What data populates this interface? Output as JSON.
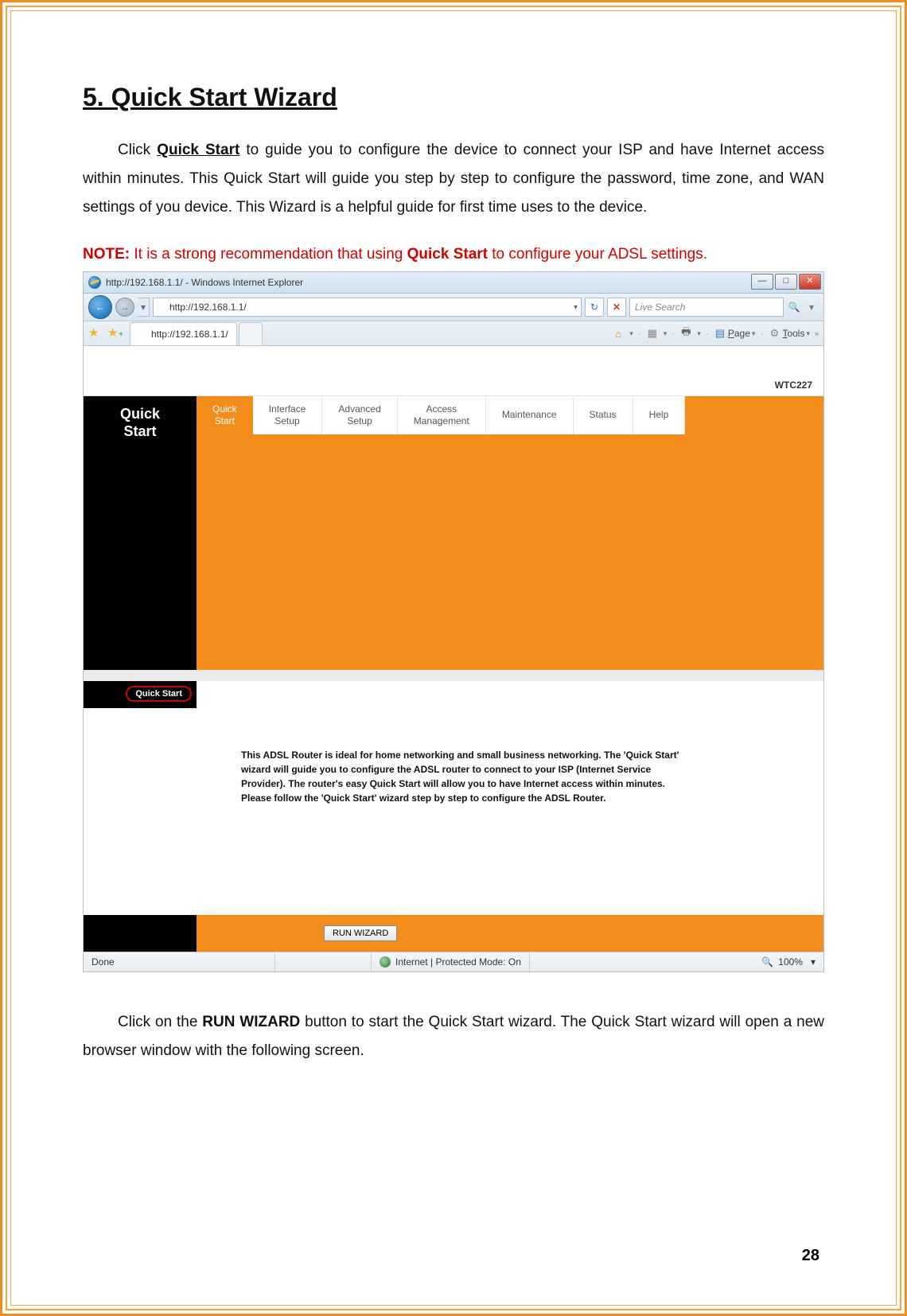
{
  "doc": {
    "section_title": "5. Quick Start Wizard",
    "para1_prefix": "Click ",
    "para1_link": "Quick Start",
    "para1_rest": " to guide you to configure the device to connect your ISP and have Internet access within minutes. This Quick Start will guide you step by step to configure the password, time zone, and WAN settings of you device. This Wizard is a helpful guide for first time uses to the device.",
    "note_label": "NOTE:",
    "note_text_a": " It is a strong recommendation that using ",
    "note_bold": "Quick Start",
    "note_text_b": " to configure your ADSL settings.",
    "para2_a": "Click on the ",
    "para2_b": "RUN WIZARD",
    "para2_c": " button to start the Quick Start wizard. The Quick Start wizard will open a new browser window with the following screen.",
    "page_number": "28"
  },
  "ie": {
    "title": "http://192.168.1.1/ - Windows Internet Explorer",
    "url": "http://192.168.1.1/",
    "tab_label": "http://192.168.1.1/",
    "search_placeholder": "Live Search",
    "toolbar_page": "Page",
    "toolbar_tools": "Tools",
    "status_done": "Done",
    "status_zone": "Internet | Protected Mode: On",
    "status_zoom": "100%"
  },
  "router": {
    "model": "WTC227",
    "left_label": "Quick\nStart",
    "left_pill": "Quick Start",
    "nav": {
      "quick_start": "Quick\nStart",
      "interface_setup": "Interface\nSetup",
      "advanced_setup": "Advanced\nSetup",
      "access_mgmt": "Access\nManagement",
      "maintenance": "Maintenance",
      "status": "Status",
      "help": "Help"
    },
    "desc": "This ADSL Router is ideal for home networking and small business networking. The 'Quick Start' wizard will guide you to configure the ADSL router to connect to your ISP (Internet Service Provider). The router's easy Quick Start will allow you to have Internet access within minutes. Please follow the 'Quick Start' wizard step by step to configure the ADSL Router.",
    "run_wizard": "RUN WIZARD"
  }
}
